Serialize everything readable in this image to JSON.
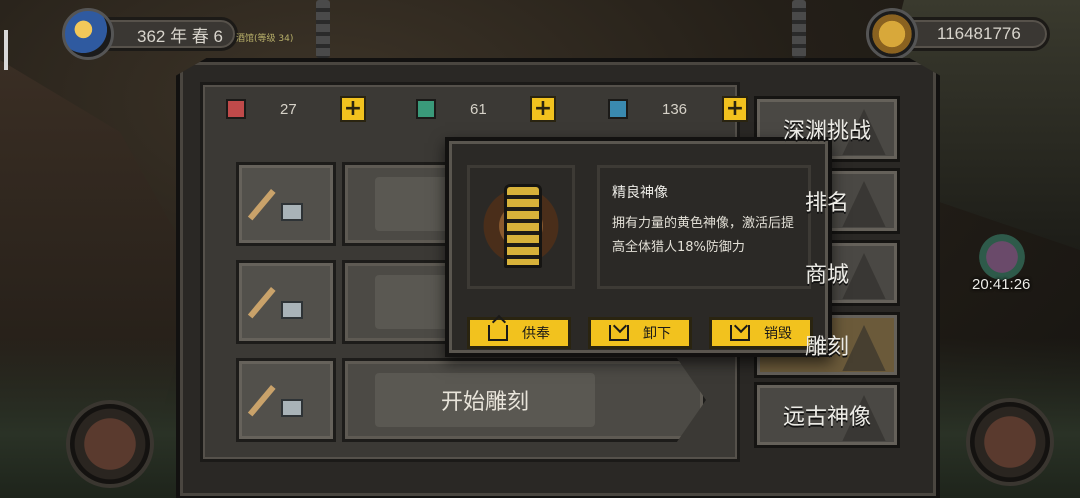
{
  "hud": {
    "date": "362 年 春 6",
    "sub_label": "酒馆(等级 34)",
    "coins": "116481776",
    "timer": "20:41:26"
  },
  "resources": [
    {
      "value": "27",
      "color": "#c04a4a"
    },
    {
      "value": "61",
      "color": "#3a9a7a"
    },
    {
      "value": "136",
      "color": "#3a8ab0"
    }
  ],
  "slots": [
    {
      "label": ""
    },
    {
      "label": ""
    },
    {
      "label": "开始雕刻"
    }
  ],
  "tabs": [
    {
      "label": "深渊挑战"
    },
    {
      "label": "排名"
    },
    {
      "label": "商城"
    },
    {
      "label": "雕刻"
    },
    {
      "label": "远古神像"
    }
  ],
  "popup": {
    "title": "精良神像",
    "description": "拥有力量的黄色神像，激活后提高全体猎人18%防御力",
    "buttons": {
      "offer": "供奉",
      "unload": "卸下",
      "destroy": "销毁"
    }
  },
  "colors": {
    "accent": "#f2c21e",
    "panel": "#2b2926"
  }
}
